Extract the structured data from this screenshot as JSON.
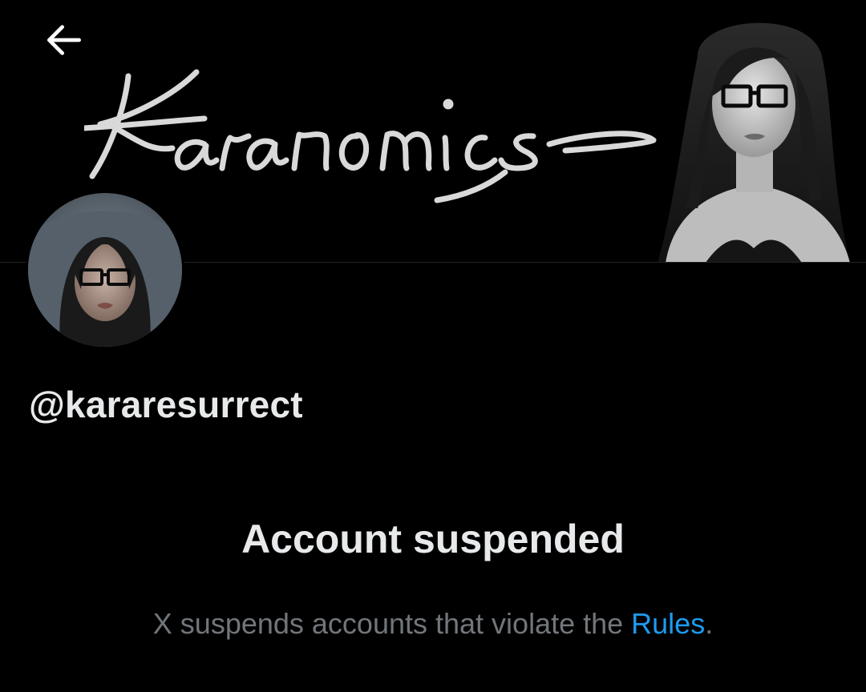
{
  "header": {
    "back_icon": "arrow-left-icon"
  },
  "banner": {
    "wordmark": "Karanomics",
    "portrait": "banner-portrait-image"
  },
  "profile": {
    "avatar": "profile-avatar-image",
    "handle": "@kararesurrect"
  },
  "suspension": {
    "title": "Account suspended",
    "message_prefix": "X suspends accounts that violate the ",
    "rules_link": "Rules",
    "message_suffix": "."
  },
  "colors": {
    "background": "#000000",
    "text_primary": "#e7e9ea",
    "text_secondary": "#71767b",
    "link": "#1d9bf0"
  }
}
